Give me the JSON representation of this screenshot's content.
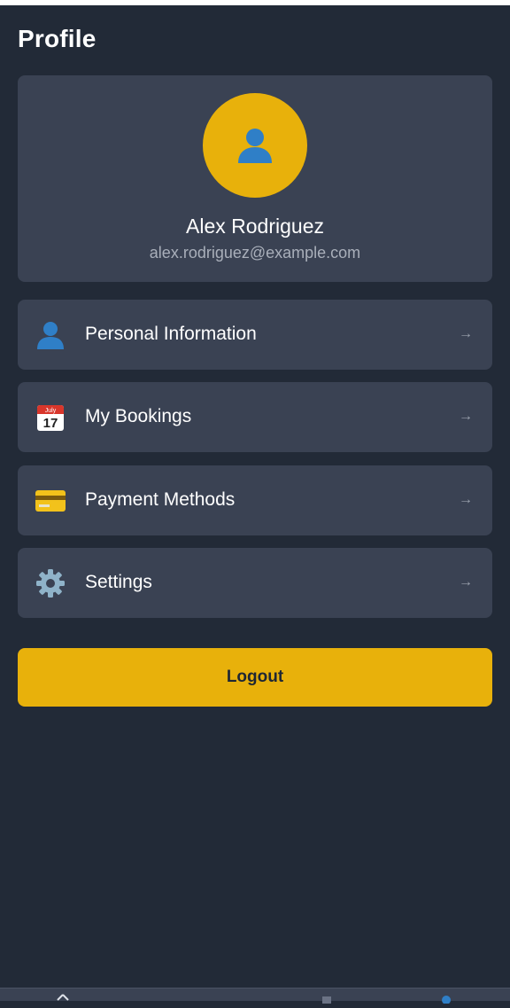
{
  "header": {
    "title": "Profile"
  },
  "profile": {
    "name": "Alex Rodriguez",
    "email": "alex.rodriguez@example.com",
    "avatar_icon": "user-silhouette-icon",
    "avatar_color": "#e8b10b"
  },
  "menu": {
    "items": [
      {
        "label": "Personal Information",
        "icon": "user-icon",
        "arrow": "→"
      },
      {
        "label": "My Bookings",
        "icon": "calendar-icon",
        "calendar_month": "July",
        "calendar_day": "17",
        "arrow": "→"
      },
      {
        "label": "Payment Methods",
        "icon": "credit-card-icon",
        "arrow": "→"
      },
      {
        "label": "Settings",
        "icon": "gear-icon",
        "arrow": "→"
      }
    ]
  },
  "actions": {
    "logout_label": "Logout"
  },
  "theme": {
    "background": "#222a37",
    "card": "#3a4253",
    "accent": "#e8b10b",
    "text_muted": "#a9afba"
  },
  "bottom_nav": {
    "items": [
      {
        "icon": "home-icon"
      },
      {
        "icon": "search-icon"
      },
      {
        "icon": "bookings-icon"
      },
      {
        "icon": "profile-icon"
      }
    ]
  }
}
